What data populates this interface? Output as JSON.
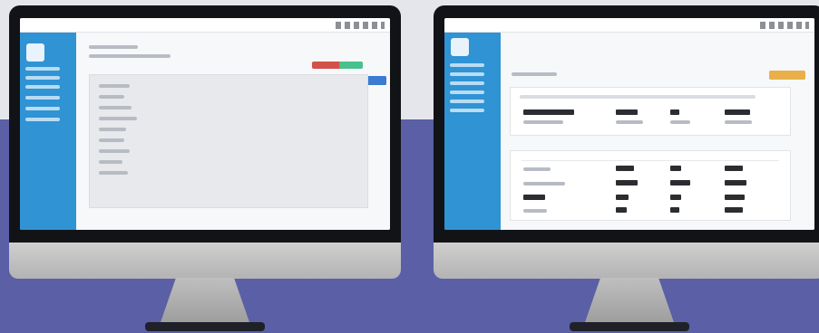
{
  "scene": {
    "background_top": "#e4e6ec",
    "background_bottom": "#5a5fa6"
  },
  "left_monitor": {
    "app_brand": "",
    "sidebar": {
      "items": [
        "",
        "",
        "",
        "",
        "",
        ""
      ]
    },
    "header": {
      "buttons": [
        "",
        "",
        ""
      ]
    },
    "list": {
      "rows": [
        "",
        "",
        "",
        "",
        "",
        "",
        "",
        "",
        ""
      ]
    }
  },
  "right_monitor": {
    "app_brand": "",
    "sidebar": {
      "items": [
        "",
        "",
        "",
        "",
        "",
        ""
      ]
    },
    "header": {
      "buttons": [
        ""
      ]
    },
    "summary": {
      "columns": [
        "",
        "",
        "",
        ""
      ]
    },
    "table": {
      "rows": [
        "",
        "",
        "",
        ""
      ]
    }
  }
}
